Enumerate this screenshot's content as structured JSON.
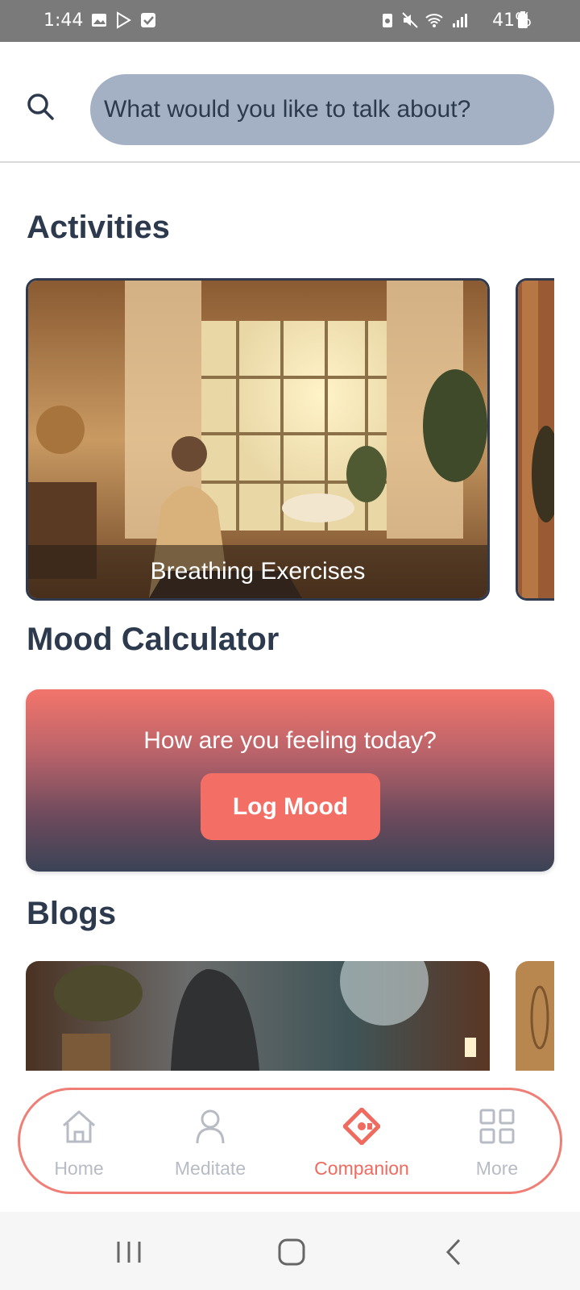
{
  "status_bar": {
    "time": "1:44",
    "battery": "41%"
  },
  "search": {
    "placeholder": "What would you like to talk about?"
  },
  "sections": {
    "activities": "Activities",
    "mood": "Mood Calculator",
    "blogs": "Blogs"
  },
  "activities": [
    {
      "caption": "Breathing Exercises"
    }
  ],
  "mood_card": {
    "question": "How are you feeling today?",
    "button": "Log Mood"
  },
  "bottom_nav": {
    "items": [
      {
        "label": "Home",
        "icon": "home-icon",
        "active": false
      },
      {
        "label": "Meditate",
        "icon": "person-icon",
        "active": false
      },
      {
        "label": "Companion",
        "icon": "companion-icon",
        "active": true
      },
      {
        "label": "More",
        "icon": "grid-icon",
        "active": false
      }
    ]
  },
  "colors": {
    "accent": "#f36f66",
    "heading": "#2d3a4e",
    "search_bg": "#a4b1c4"
  }
}
